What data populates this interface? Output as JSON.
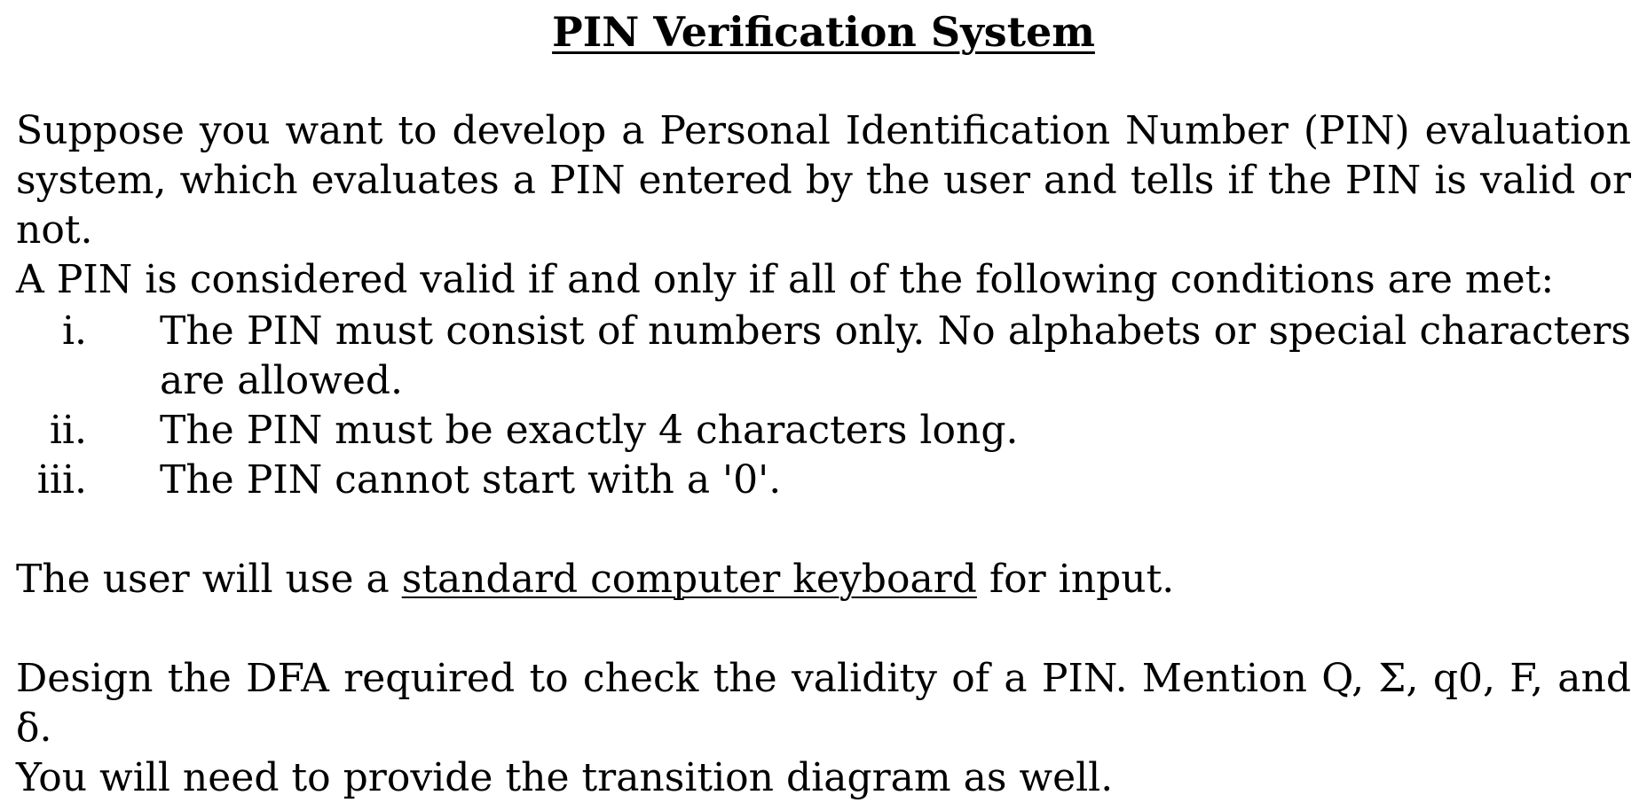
{
  "title": "PIN Verification System",
  "intro": {
    "line1": "Suppose you want to develop a Personal Identification Number (PIN) evaluation system, which evaluates a PIN entered by the user and tells if the PIN is valid or not.",
    "line2": "A PIN is considered valid if and only if all of the following conditions are met:"
  },
  "conditions": [
    {
      "num": "i.",
      "text": "The PIN must consist of numbers only. No alphabets or special characters are allowed."
    },
    {
      "num": "ii.",
      "text": "The PIN must be exactly 4 characters long."
    },
    {
      "num": "iii.",
      "text": "The PIN cannot start with a '0'."
    }
  ],
  "keyboard": {
    "before": "The user will use a ",
    "term": "standard computer keyboard",
    "after": " for input."
  },
  "task": {
    "line1": "Design the DFA required to check the validity of a PIN. Mention Q, Σ, q0, F, and δ.",
    "line2": "You will need to provide the transition diagram as well."
  }
}
